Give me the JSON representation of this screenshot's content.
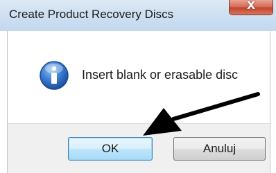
{
  "window": {
    "title": "Create Product Recovery Discs",
    "close_glyph": "X"
  },
  "content": {
    "icon": "information-icon",
    "message": "Insert blank or erasable disc"
  },
  "buttons": {
    "ok_label": "OK",
    "cancel_label": "Anuluj"
  },
  "annotation": {
    "arrow": "black-pointer-arrow"
  },
  "colors": {
    "titlebar": "#cfe0f2",
    "close_button": "#c2432b",
    "info_icon": "#2e68b8",
    "ok_border": "#3c7fb1"
  }
}
